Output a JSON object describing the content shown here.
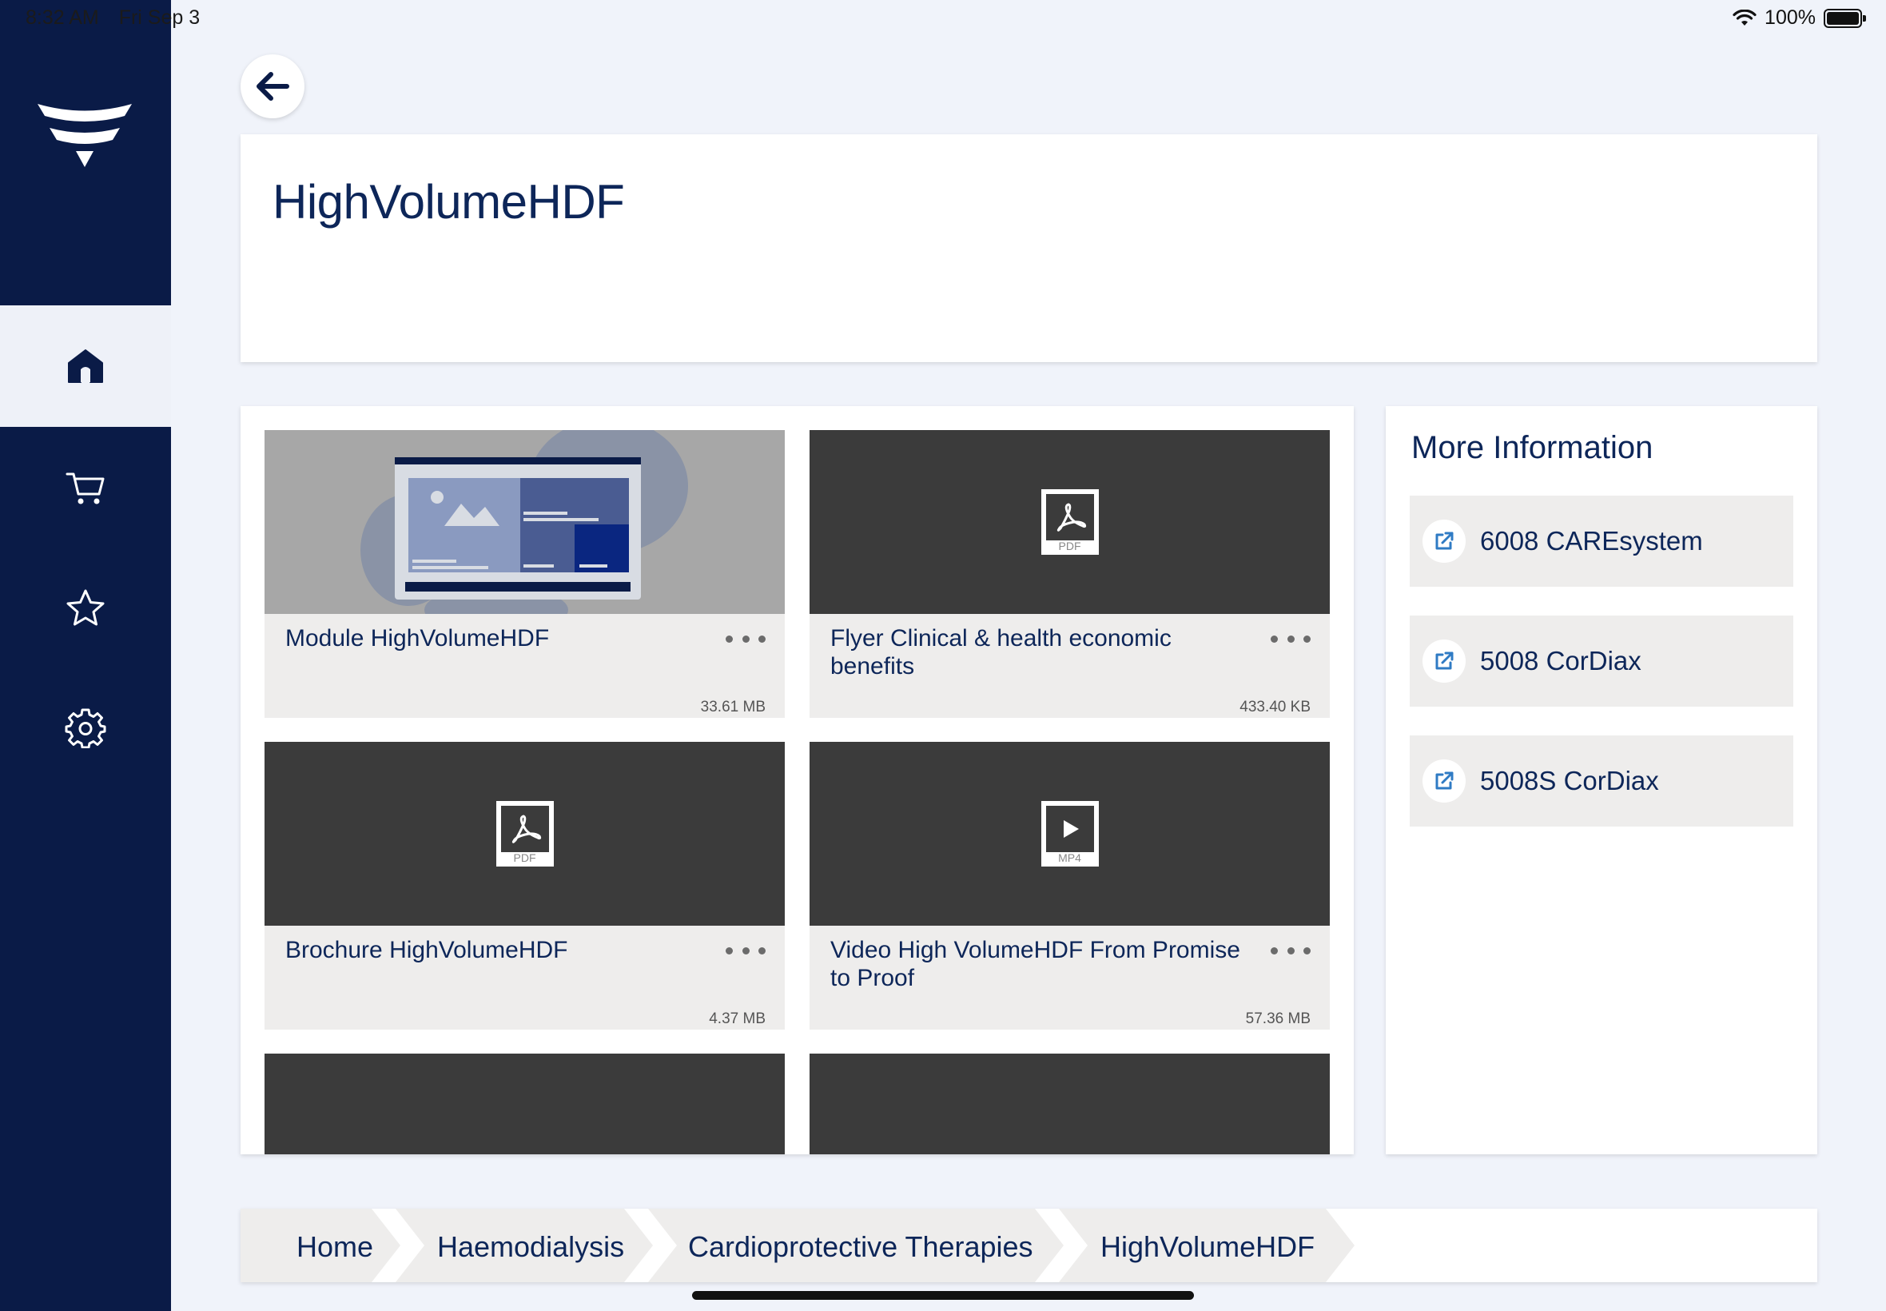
{
  "status_bar": {
    "time": "8:32 AM",
    "date": "Fri Sep 3",
    "battery": "100%"
  },
  "sidebar": {
    "items": [
      {
        "icon": "home-icon",
        "active": true
      },
      {
        "icon": "cart-icon",
        "active": false
      },
      {
        "icon": "star-icon",
        "active": false
      },
      {
        "icon": "gear-icon",
        "active": false
      }
    ]
  },
  "header": {
    "title": "HighVolumeHDF"
  },
  "tiles": [
    {
      "title": "Module HighVolumeHDF",
      "size": "33.61 MB",
      "type": "module"
    },
    {
      "title": "Flyer Clinical & health economic benefits",
      "size": "433.40 KB",
      "type": "PDF"
    },
    {
      "title": "Brochure HighVolumeHDF",
      "size": "4.37 MB",
      "type": "PDF"
    },
    {
      "title": "Video High VolumeHDF From Promise to Proof",
      "size": "57.36 MB",
      "type": "MP4"
    }
  ],
  "info": {
    "title": "More Information",
    "links": [
      "6008 CAREsystem",
      "5008 CorDiax",
      "5008S CorDiax"
    ]
  },
  "breadcrumb": [
    "Home",
    "Haemodialysis",
    "Cardioprotective Therapies",
    "HighVolumeHDF"
  ]
}
